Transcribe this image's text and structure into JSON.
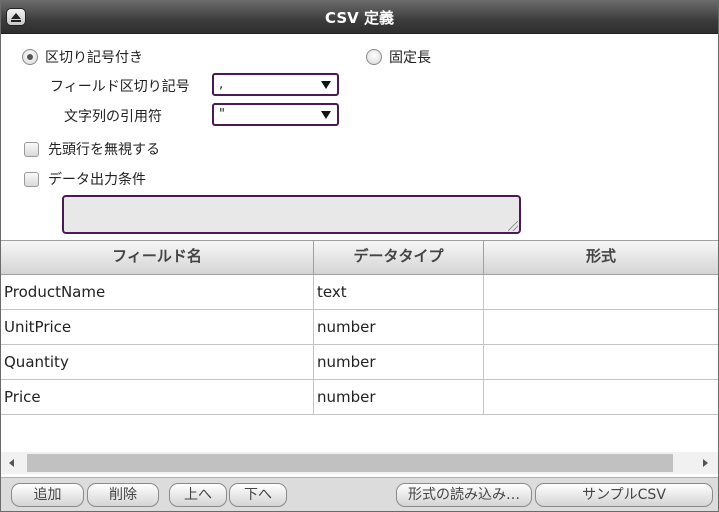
{
  "window": {
    "title": "CSV 定義"
  },
  "format": {
    "delimited_label": "区切り記号付き",
    "fixed_label": "固定長",
    "delimited_selected": true
  },
  "delimiter": {
    "label": "フィールド区切り記号",
    "value": ","
  },
  "quote": {
    "label": "文字列の引用符",
    "value": "\""
  },
  "options": {
    "ignore_first_row": "先頭行を無視する",
    "data_output_condition": "データ出力条件"
  },
  "condition": {
    "value": ""
  },
  "table": {
    "columns": [
      "フィールド名",
      "データタイプ",
      "形式"
    ],
    "rows": [
      [
        "ProductName",
        "text",
        ""
      ],
      [
        "UnitPrice",
        "number",
        ""
      ],
      [
        "Quantity",
        "number",
        ""
      ],
      [
        "Price",
        "number",
        ""
      ]
    ]
  },
  "buttons": {
    "add": "追加",
    "delete": "削除",
    "up": "上へ",
    "down": "下へ",
    "load_format": "形式の読み込み…",
    "sample_csv": "サンプルCSV"
  },
  "colors": {
    "accent_border": "#4b1a55",
    "titlebar": "#3c3c3c"
  }
}
